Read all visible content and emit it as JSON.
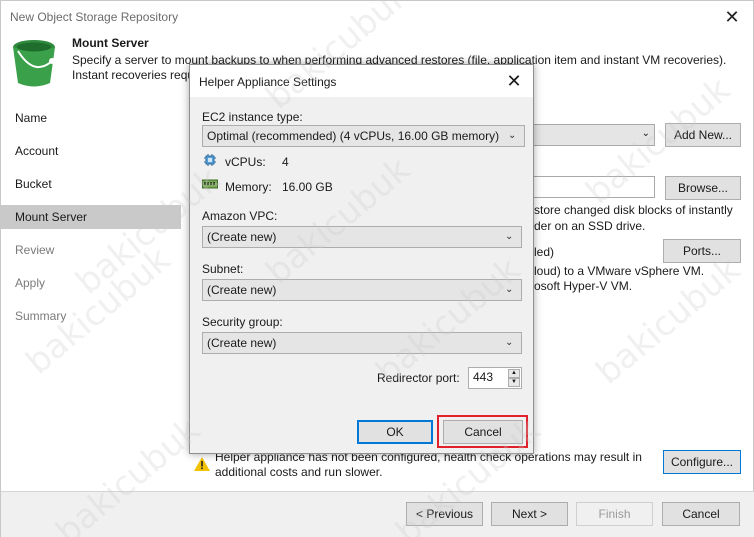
{
  "window": {
    "title": "New Object Storage Repository",
    "close_glyph": "✕"
  },
  "header": {
    "title": "Mount Server",
    "description_line1": "Specify a server to mount backups to when performing advanced restores (file, application item and instant VM recoveries).",
    "description_line2": "Instant recoveries requ"
  },
  "sidebar": {
    "items": [
      {
        "label": "Name",
        "state": "normal"
      },
      {
        "label": "Account",
        "state": "normal"
      },
      {
        "label": "Bucket",
        "state": "normal"
      },
      {
        "label": "Mount Server",
        "state": "selected"
      },
      {
        "label": "Review",
        "state": "disabled"
      },
      {
        "label": "Apply",
        "state": "disabled"
      },
      {
        "label": "Summary",
        "state": "disabled"
      }
    ]
  },
  "background": {
    "add_new_label": "Add New...",
    "browse_label": "Browse...",
    "line_store_1": "store changed disk blocks of instantly",
    "line_store_2": "der on an SSD drive.",
    "line_led": "led)",
    "ports_label": "Ports...",
    "line_cloud": "loud) to a VMware vSphere VM.",
    "line_hyperv": "osoft Hyper-V VM.",
    "warning_line1": "Helper appliance has not been configured, health check operations may result in",
    "warning_line2": "additional costs and run slower.",
    "configure_label": "Configure..."
  },
  "footer": {
    "previous_label": "< Previous",
    "next_label": "Next >",
    "finish_label": "Finish",
    "cancel_label": "Cancel"
  },
  "dialog": {
    "title": "Helper Appliance Settings",
    "close_glyph": "✕",
    "ec2_label": "EC2 instance type:",
    "ec2_value": "Optimal (recommended) (4 vCPUs, 16.00 GB memory)",
    "vcpus_label": "vCPUs:",
    "vcpus_value": "4",
    "memory_label": "Memory:",
    "memory_value": "16.00 GB",
    "vpc_label": "Amazon VPC:",
    "vpc_value": "(Create new)",
    "subnet_label": "Subnet:",
    "subnet_value": "(Create new)",
    "security_label": "Security group:",
    "security_value": "(Create new)",
    "redirector_label": "Redirector port:",
    "redirector_value": "443",
    "ok_label": "OK",
    "cancel_label": "Cancel"
  },
  "colors": {
    "selected_nav_bg": "#c9c9c9",
    "accent_blue": "#0078d7",
    "highlight_red": "#e0202a",
    "bucket_green": "#3aa04a",
    "warning_yellow": "#f2c200"
  },
  "icons": {
    "bucket": "bucket-icon",
    "cpu": "cpu-icon",
    "memory": "memory-icon",
    "warning": "warning-icon",
    "chevron": "chevron-down-icon"
  },
  "watermark_text": "bakicubuk"
}
